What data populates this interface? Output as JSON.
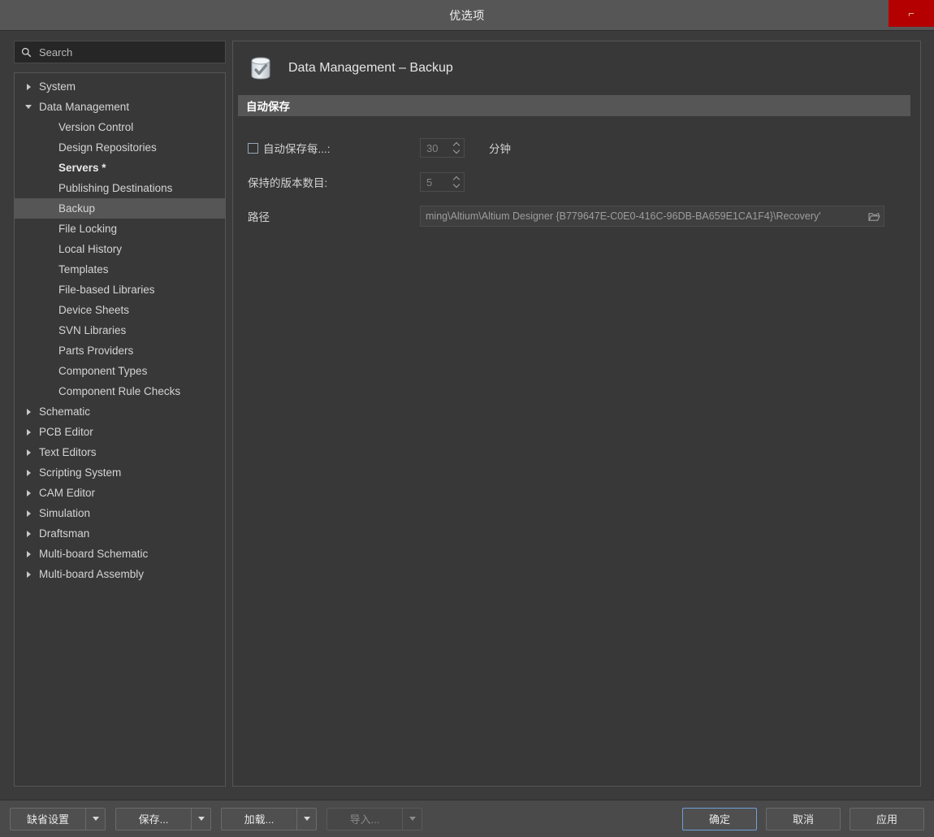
{
  "window": {
    "title": "优选项",
    "close_label": "⌐",
    "close_icon": "close-icon"
  },
  "search": {
    "placeholder": "Search",
    "value": "",
    "icon": "search-icon"
  },
  "tree": {
    "items": [
      {
        "label": "System",
        "level": 0,
        "expander": "collapsed",
        "selected": false,
        "bold": false
      },
      {
        "label": "Data Management",
        "level": 0,
        "expander": "expanded",
        "selected": false,
        "bold": false
      },
      {
        "label": "Version Control",
        "level": 1,
        "expander": "none",
        "selected": false,
        "bold": false
      },
      {
        "label": "Design Repositories",
        "level": 1,
        "expander": "none",
        "selected": false,
        "bold": false
      },
      {
        "label": "Servers *",
        "level": 1,
        "expander": "none",
        "selected": false,
        "bold": true
      },
      {
        "label": "Publishing Destinations",
        "level": 1,
        "expander": "none",
        "selected": false,
        "bold": false
      },
      {
        "label": "Backup",
        "level": 1,
        "expander": "none",
        "selected": true,
        "bold": false
      },
      {
        "label": "File Locking",
        "level": 1,
        "expander": "none",
        "selected": false,
        "bold": false
      },
      {
        "label": "Local History",
        "level": 1,
        "expander": "none",
        "selected": false,
        "bold": false
      },
      {
        "label": "Templates",
        "level": 1,
        "expander": "none",
        "selected": false,
        "bold": false
      },
      {
        "label": "File-based Libraries",
        "level": 1,
        "expander": "none",
        "selected": false,
        "bold": false
      },
      {
        "label": "Device Sheets",
        "level": 1,
        "expander": "none",
        "selected": false,
        "bold": false
      },
      {
        "label": "SVN Libraries",
        "level": 1,
        "expander": "none",
        "selected": false,
        "bold": false
      },
      {
        "label": "Parts Providers",
        "level": 1,
        "expander": "none",
        "selected": false,
        "bold": false
      },
      {
        "label": "Component Types",
        "level": 1,
        "expander": "none",
        "selected": false,
        "bold": false
      },
      {
        "label": "Component Rule Checks",
        "level": 1,
        "expander": "none",
        "selected": false,
        "bold": false
      },
      {
        "label": "Schematic",
        "level": 0,
        "expander": "collapsed",
        "selected": false,
        "bold": false
      },
      {
        "label": "PCB Editor",
        "level": 0,
        "expander": "collapsed",
        "selected": false,
        "bold": false
      },
      {
        "label": "Text Editors",
        "level": 0,
        "expander": "collapsed",
        "selected": false,
        "bold": false
      },
      {
        "label": "Scripting System",
        "level": 0,
        "expander": "collapsed",
        "selected": false,
        "bold": false
      },
      {
        "label": "CAM Editor",
        "level": 0,
        "expander": "collapsed",
        "selected": false,
        "bold": false
      },
      {
        "label": "Simulation",
        "level": 0,
        "expander": "collapsed",
        "selected": false,
        "bold": false
      },
      {
        "label": "Draftsman",
        "level": 0,
        "expander": "collapsed",
        "selected": false,
        "bold": false
      },
      {
        "label": "Multi-board Schematic",
        "level": 0,
        "expander": "collapsed",
        "selected": false,
        "bold": false
      },
      {
        "label": "Multi-board Assembly",
        "level": 0,
        "expander": "collapsed",
        "selected": false,
        "bold": false
      }
    ]
  },
  "page": {
    "icon": "database-check-icon",
    "title": "Data Management – Backup",
    "section": {
      "title": "自动保存"
    },
    "fields": {
      "autosave": {
        "label": "自动保存每...:",
        "checked": false,
        "value": "30",
        "unit": "分钟"
      },
      "versions": {
        "label": "保持的版本数目:",
        "value": "5"
      },
      "path": {
        "label": "路径",
        "value": "ming\\Altium\\Altium Designer {B779647E-C0E0-416C-96DB-BA659E1CA1F4}\\Recovery'",
        "browse_icon": "folder-open-icon"
      }
    }
  },
  "footer": {
    "left_buttons": [
      {
        "label": "缺省设置",
        "disabled": false,
        "name": "default-settings-button"
      },
      {
        "label": "保存...",
        "disabled": false,
        "name": "save-button"
      },
      {
        "label": "加载...",
        "disabled": false,
        "name": "load-button"
      },
      {
        "label": "导入...",
        "disabled": true,
        "name": "import-button"
      }
    ],
    "ok_label": "确定",
    "cancel_label": "取消",
    "apply_label": "应用"
  },
  "colors": {
    "accent_close": "#b40000",
    "focus_border": "#6f9fd8",
    "window_bg": "#3b3b3b",
    "panel_bg": "#383838",
    "titlebar_bg": "#565656"
  }
}
